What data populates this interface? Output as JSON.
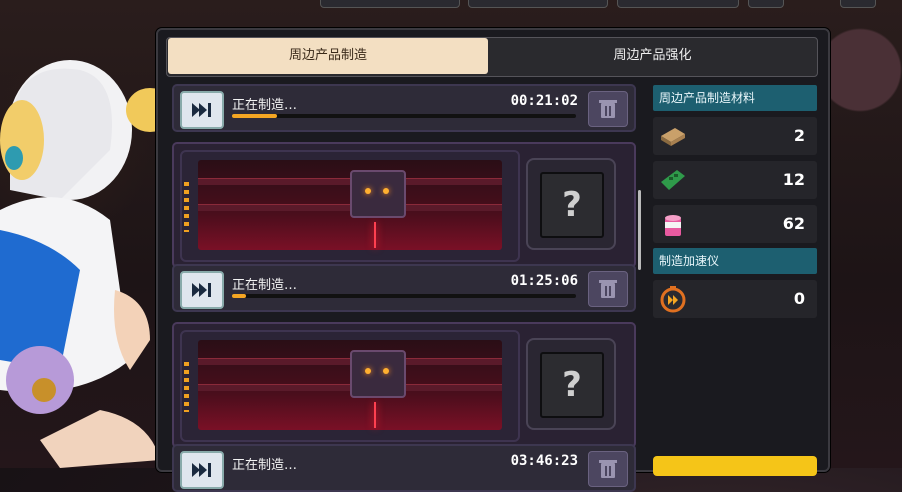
{
  "tabs": {
    "active": "周边产品制造",
    "inactive": "周边产品强化"
  },
  "slots": [
    {
      "status": "正在制造…",
      "time": "00:21:02",
      "progress": 0.13
    },
    {
      "status": "正在制造…",
      "time": "01:25:06",
      "progress": 0.04,
      "preview": "?"
    },
    {
      "status": "正在制造…",
      "time": "03:46:23",
      "progress": 0.0,
      "preview": "?"
    }
  ],
  "materials": {
    "title": "周边产品制造材料",
    "items": [
      {
        "icon": "wood-planks-icon",
        "count": "2"
      },
      {
        "icon": "circuit-board-icon",
        "count": "12"
      },
      {
        "icon": "paint-bucket-icon",
        "count": "62"
      }
    ]
  },
  "accelerator": {
    "title": "制造加速仪",
    "icon": "speedup-icon",
    "count": "0"
  },
  "colors": {
    "accent": "#f5a623",
    "tab_active": "#f3dfc2",
    "side_header": "#1d5f70"
  }
}
